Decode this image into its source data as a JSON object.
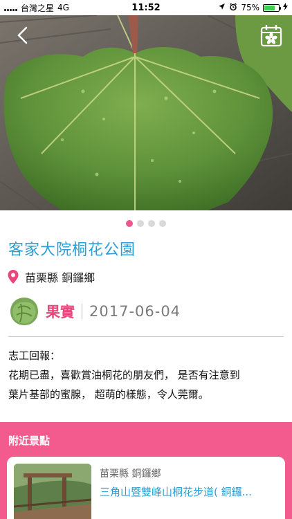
{
  "status": {
    "carrier": "台灣之星",
    "network": "4G",
    "time": "11:52",
    "battery": "75%",
    "battery_level": 0.75
  },
  "pager": {
    "count": 4,
    "active": 0
  },
  "title": "客家大院桐花公園",
  "location": "苗栗縣 銅鑼鄉",
  "stage": {
    "label": "果實",
    "date": "2017-06-04"
  },
  "report": {
    "heading": "志工回報：",
    "lines": [
      "花期已盡，喜歡賞油桐花的朋友們， 是否有注意到",
      "葉片基部的蜜腺， 超萌的樣態，令人莞爾。"
    ]
  },
  "nearby": {
    "title": "附近景點",
    "items": [
      {
        "location": "苗栗縣 銅鑼鄉",
        "name": "三角山暨雙峰山桐花步道( 銅鑼..."
      }
    ]
  },
  "colors": {
    "accent_pink": "#f35b8f",
    "title_blue": "#2b9fd6",
    "stage_pink": "#e8467c"
  }
}
